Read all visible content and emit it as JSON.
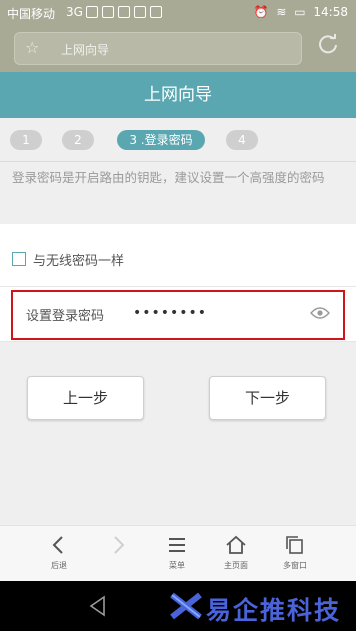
{
  "status_bar": {
    "carrier": "中国移动",
    "network": "3G",
    "signal_label": "3G",
    "battery": "",
    "time": "14:58"
  },
  "browser": {
    "url_text": "上网向导",
    "star_icon": "star-icon",
    "refresh_icon": "refresh-icon"
  },
  "header": {
    "title": "上网向导"
  },
  "steps": [
    {
      "label": "1"
    },
    {
      "label": "2"
    },
    {
      "label": "3 .登录密码"
    },
    {
      "label": "4"
    }
  ],
  "description": "登录密码是开启路由的钥匙，建议设置一个高强度的密码",
  "sync_option": {
    "label": "与无线密码一样",
    "checked": false
  },
  "password": {
    "label": "设置登录密码",
    "value": "••••••••",
    "highlight_color": "#d0141b"
  },
  "buttons": {
    "prev": "上一步",
    "next": "下一步"
  },
  "toolbar": {
    "items": [
      {
        "icon": "back-icon",
        "label": "后退"
      },
      {
        "icon": "forward-icon",
        "label": ""
      },
      {
        "icon": "menu-icon",
        "label": "菜单"
      },
      {
        "icon": "home-icon",
        "label": "主页面"
      },
      {
        "icon": "windows-icon",
        "label": "多窗口"
      }
    ]
  },
  "watermark": {
    "text": "易企推科技"
  },
  "colors": {
    "accent": "#5aa7b2",
    "status_bar": "#a8aa96",
    "page_bg": "#efefef"
  }
}
